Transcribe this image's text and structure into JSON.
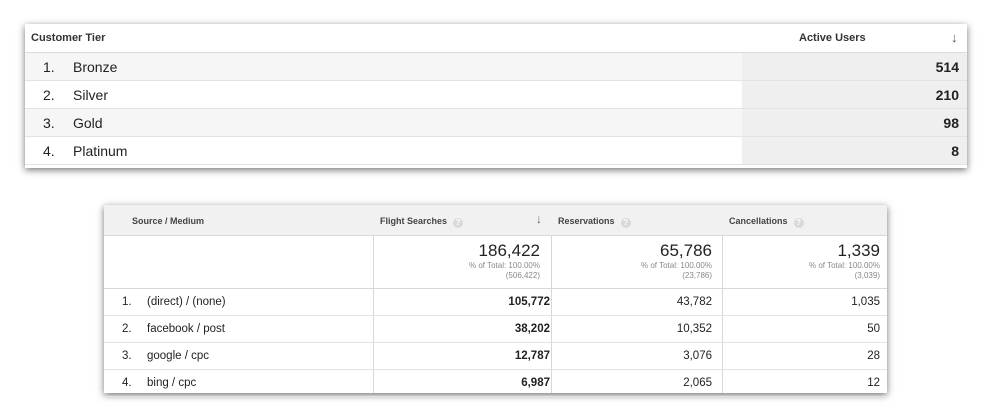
{
  "tier_table": {
    "header": {
      "dimension": "Customer Tier",
      "metric": "Active Users",
      "sort_icon": "↓"
    },
    "rows": [
      {
        "index": "1.",
        "label": "Bronze",
        "value": "514"
      },
      {
        "index": "2.",
        "label": "Silver",
        "value": "210"
      },
      {
        "index": "3.",
        "label": "Gold",
        "value": "98"
      },
      {
        "index": "4.",
        "label": "Platinum",
        "value": "8"
      }
    ]
  },
  "source_table": {
    "header": {
      "dimension": "Source / Medium",
      "col1": "Flight Searches",
      "col2": "Reservations",
      "col3": "Cancellations",
      "help_icon": "?",
      "sort_icon": "↓"
    },
    "totals": [
      {
        "value": "186,422",
        "pct": "% of Total: 100.00%",
        "abs": "(506,422)"
      },
      {
        "value": "65,786",
        "pct": "% of Total: 100.00%",
        "abs": "(23,786)"
      },
      {
        "value": "1,339",
        "pct": "% of Total: 100.00%",
        "abs": "(3,039)"
      }
    ],
    "rows": [
      {
        "index": "1.",
        "label": "(direct) / (none)",
        "c1": "105,772",
        "c2": "43,782",
        "c3": "1,035"
      },
      {
        "index": "2.",
        "label": "facebook / post",
        "c1": "38,202",
        "c2": "10,352",
        "c3": "50"
      },
      {
        "index": "3.",
        "label": "google / cpc",
        "c1": "12,787",
        "c2": "3,076",
        "c3": "28"
      },
      {
        "index": "4.",
        "label": "bing / cpc",
        "c1": "6,987",
        "c2": "2,065",
        "c3": "12"
      }
    ]
  }
}
